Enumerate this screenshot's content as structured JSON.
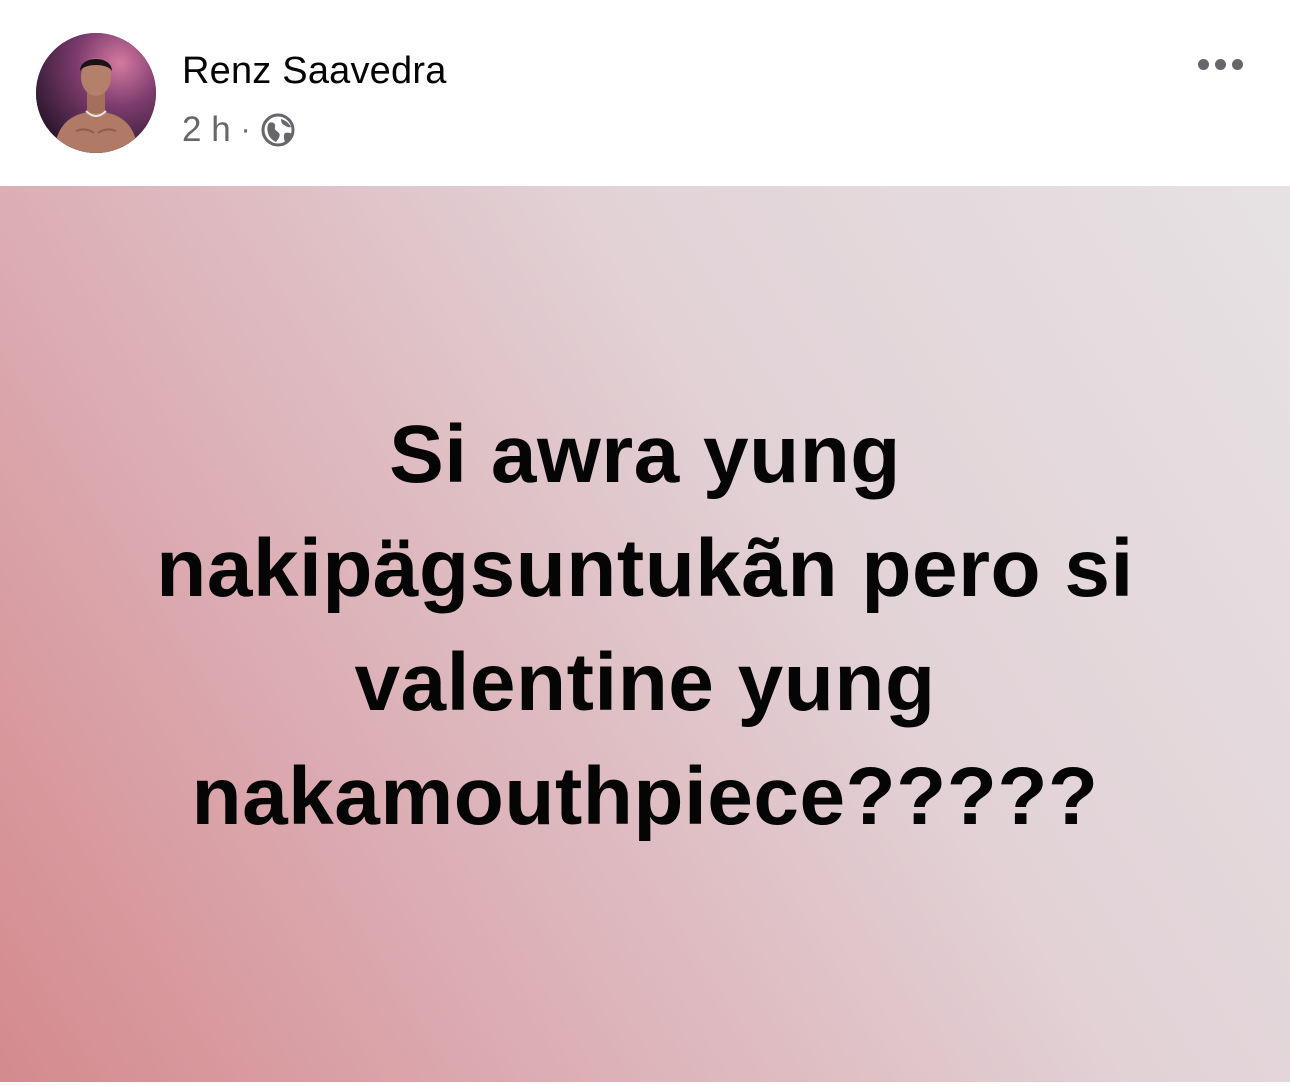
{
  "post": {
    "author_name": "Renz Saavedra",
    "timestamp": "2 h",
    "separator": "·",
    "privacy_icon": "globe-icon",
    "more_icon": "more-options-icon",
    "text": "Si awra yung nakipägsuntukãn pero si valentine yung nakamouthpiece?????"
  },
  "colors": {
    "name": "#050505",
    "meta": "#65676b",
    "background_start": "#d48a8e",
    "background_end": "#e6e2e4"
  }
}
